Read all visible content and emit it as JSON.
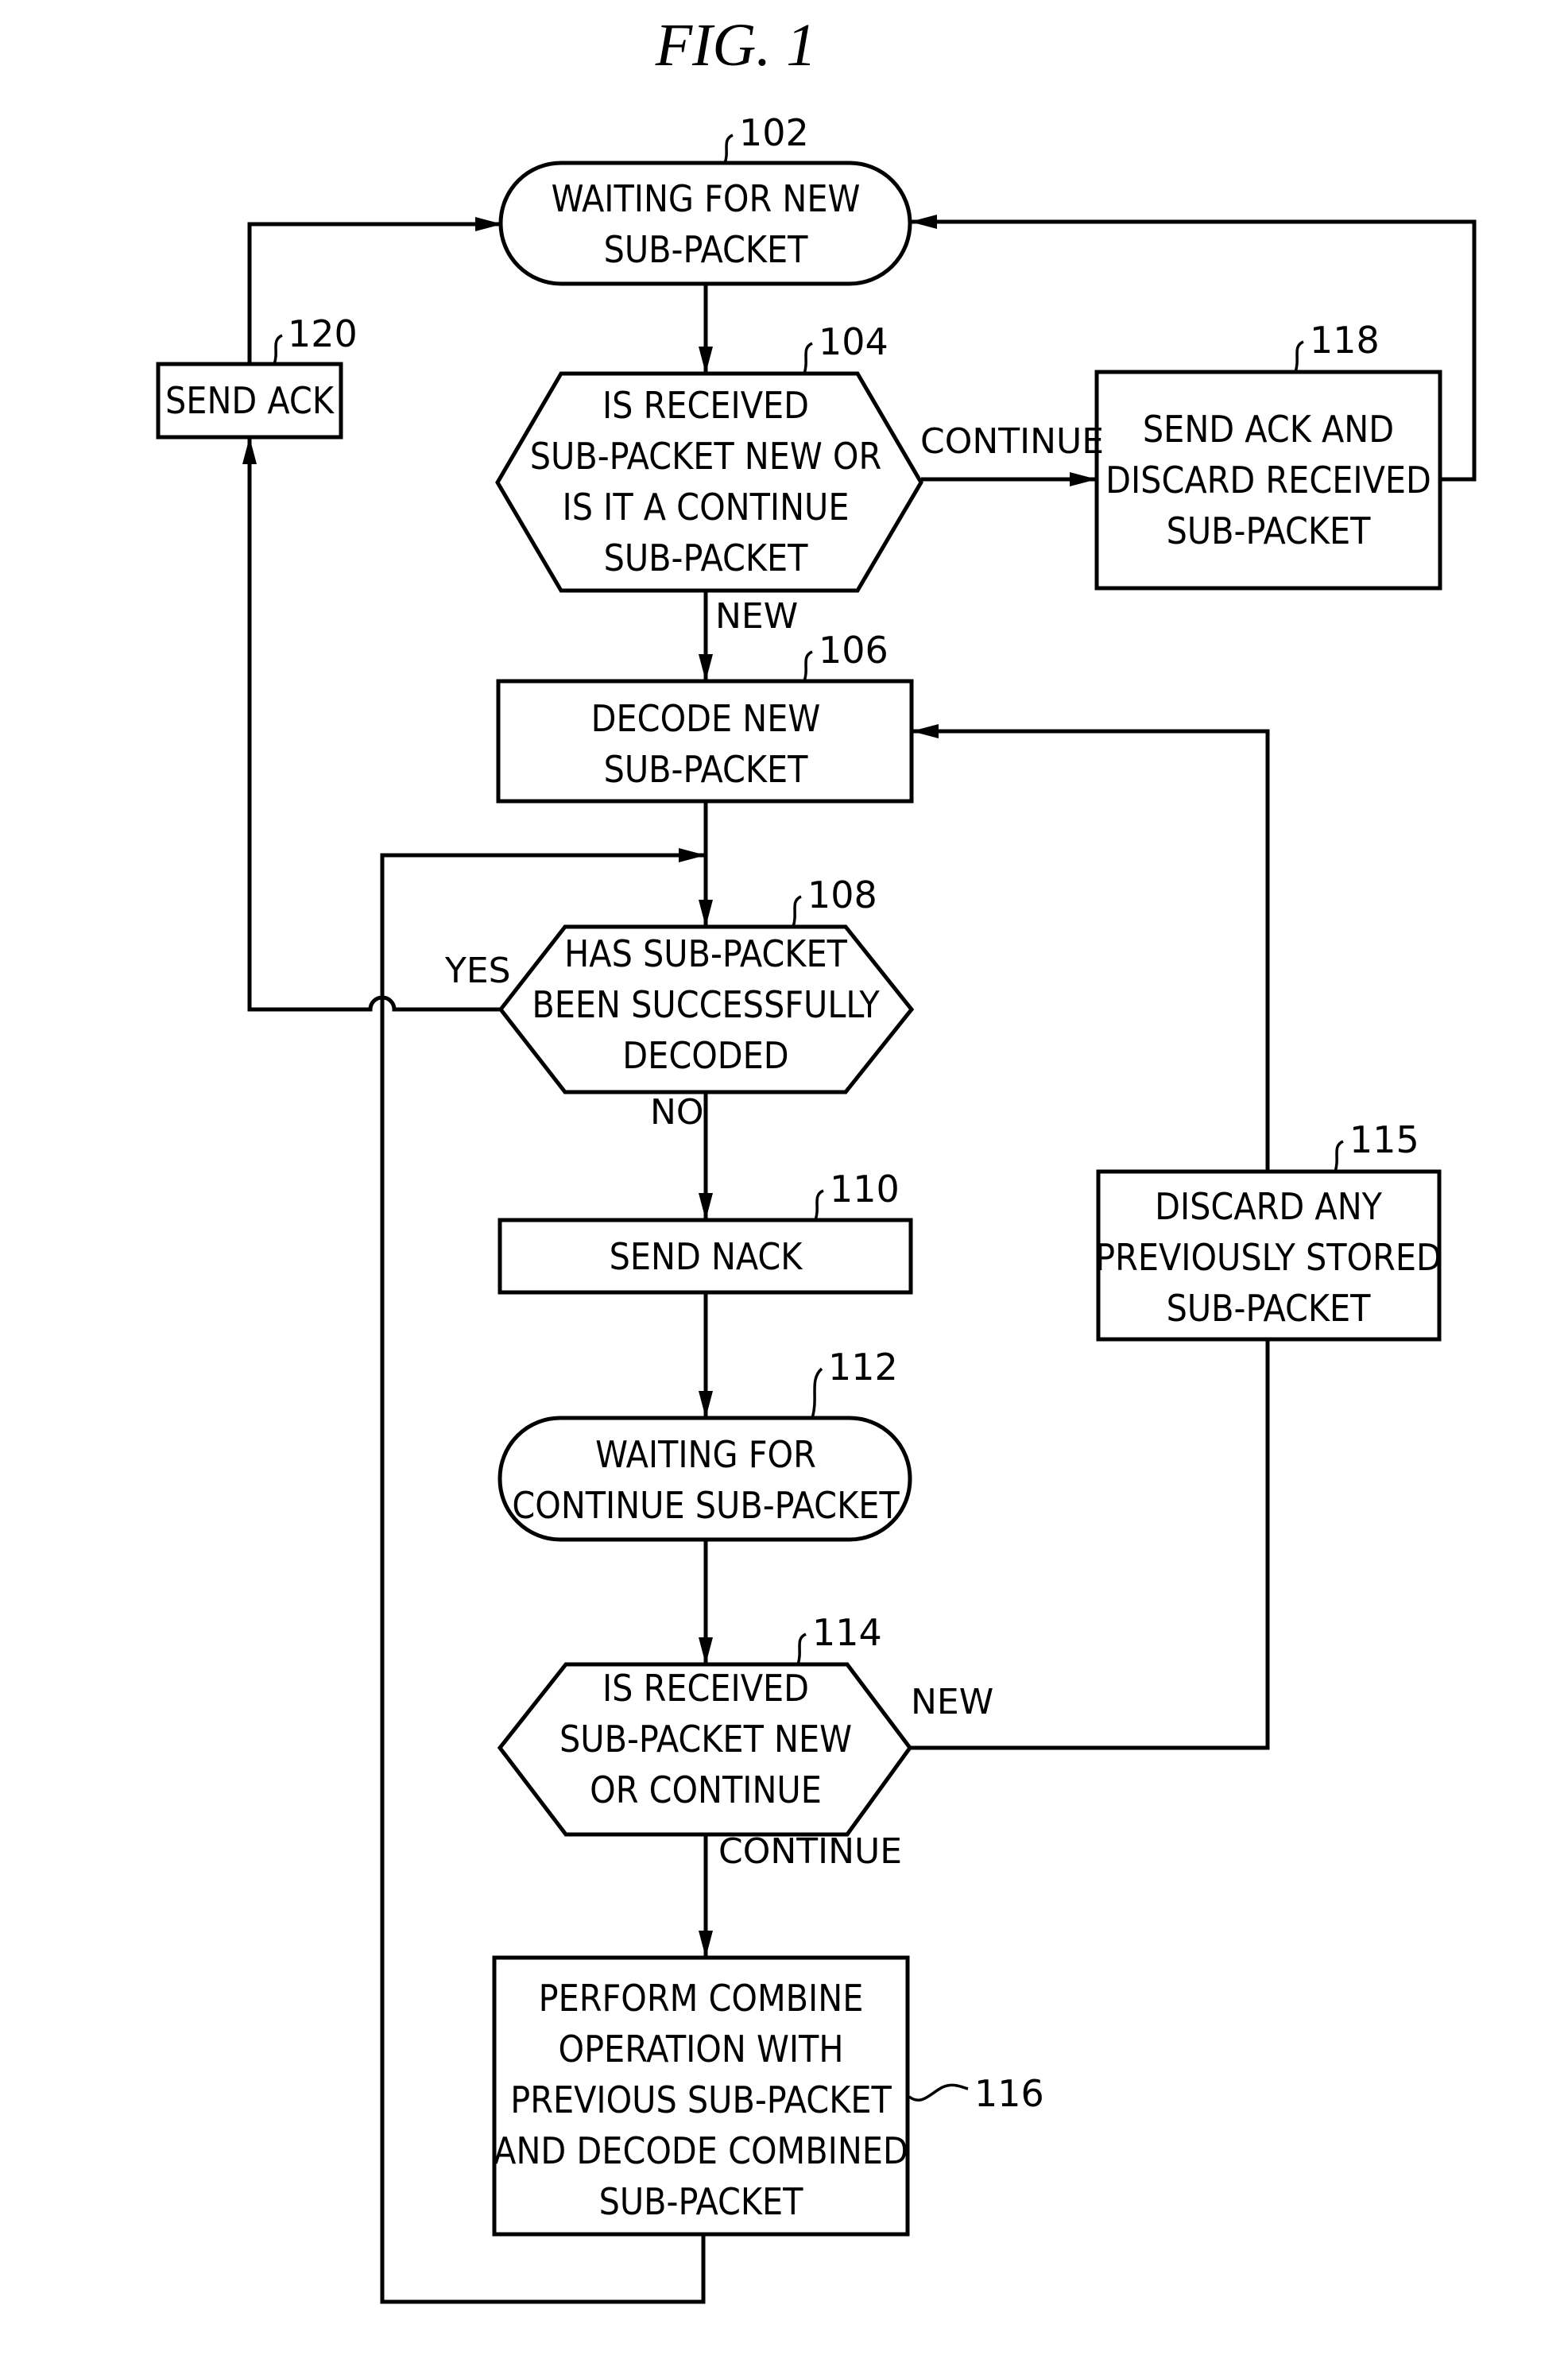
{
  "figure": {
    "title": "FIG.  1"
  },
  "nodes": {
    "n102": {
      "ref": "102",
      "type": "terminal",
      "lines": [
        "WAITING FOR NEW",
        "SUB-PACKET"
      ]
    },
    "n104": {
      "ref": "104",
      "type": "decision",
      "lines": [
        "IS RECEIVED",
        "SUB-PACKET NEW OR",
        "IS IT A CONTINUE",
        "SUB-PACKET"
      ]
    },
    "n106": {
      "ref": "106",
      "type": "process",
      "lines": [
        "DECODE NEW",
        "SUB-PACKET"
      ]
    },
    "n108": {
      "ref": "108",
      "type": "decision",
      "lines": [
        "HAS SUB-PACKET",
        "BEEN SUCCESSFULLY",
        "DECODED"
      ]
    },
    "n110": {
      "ref": "110",
      "type": "process",
      "lines": [
        "SEND NACK"
      ]
    },
    "n112": {
      "ref": "112",
      "type": "terminal",
      "lines": [
        "WAITING FOR",
        "CONTINUE SUB-PACKET"
      ]
    },
    "n114": {
      "ref": "114",
      "type": "decision",
      "lines": [
        "IS RECEIVED",
        "SUB-PACKET NEW",
        "OR CONTINUE"
      ]
    },
    "n115": {
      "ref": "115",
      "type": "process",
      "lines": [
        "DISCARD ANY",
        "PREVIOUSLY STORED",
        "SUB-PACKET"
      ]
    },
    "n116": {
      "ref": "116",
      "type": "process",
      "lines": [
        "PERFORM COMBINE",
        "OPERATION WITH",
        "PREVIOUS SUB-PACKET",
        "AND DECODE COMBINED",
        "SUB-PACKET"
      ]
    },
    "n118": {
      "ref": "118",
      "type": "process",
      "lines": [
        "SEND ACK AND",
        "DISCARD RECEIVED",
        "SUB-PACKET"
      ]
    },
    "n120": {
      "ref": "120",
      "type": "process",
      "lines": [
        "SEND ACK"
      ]
    }
  },
  "edge_labels": {
    "e104_continue": "CONTINUE",
    "e104_new": "NEW",
    "e108_yes": "YES",
    "e108_no": "NO",
    "e114_new": "NEW",
    "e114_continue": "CONTINUE"
  },
  "edges": [
    {
      "from": "102",
      "to": "104"
    },
    {
      "from": "104",
      "to": "118",
      "label": "CONTINUE"
    },
    {
      "from": "118",
      "to": "102"
    },
    {
      "from": "104",
      "to": "106",
      "label": "NEW"
    },
    {
      "from": "106",
      "to": "108"
    },
    {
      "from": "108",
      "to": "120",
      "label": "YES"
    },
    {
      "from": "120",
      "to": "102"
    },
    {
      "from": "108",
      "to": "110",
      "label": "NO"
    },
    {
      "from": "110",
      "to": "112"
    },
    {
      "from": "112",
      "to": "114"
    },
    {
      "from": "114",
      "to": "115",
      "label": "NEW"
    },
    {
      "from": "115",
      "to": "106"
    },
    {
      "from": "114",
      "to": "116",
      "label": "CONTINUE"
    },
    {
      "from": "116",
      "to": "108"
    }
  ]
}
